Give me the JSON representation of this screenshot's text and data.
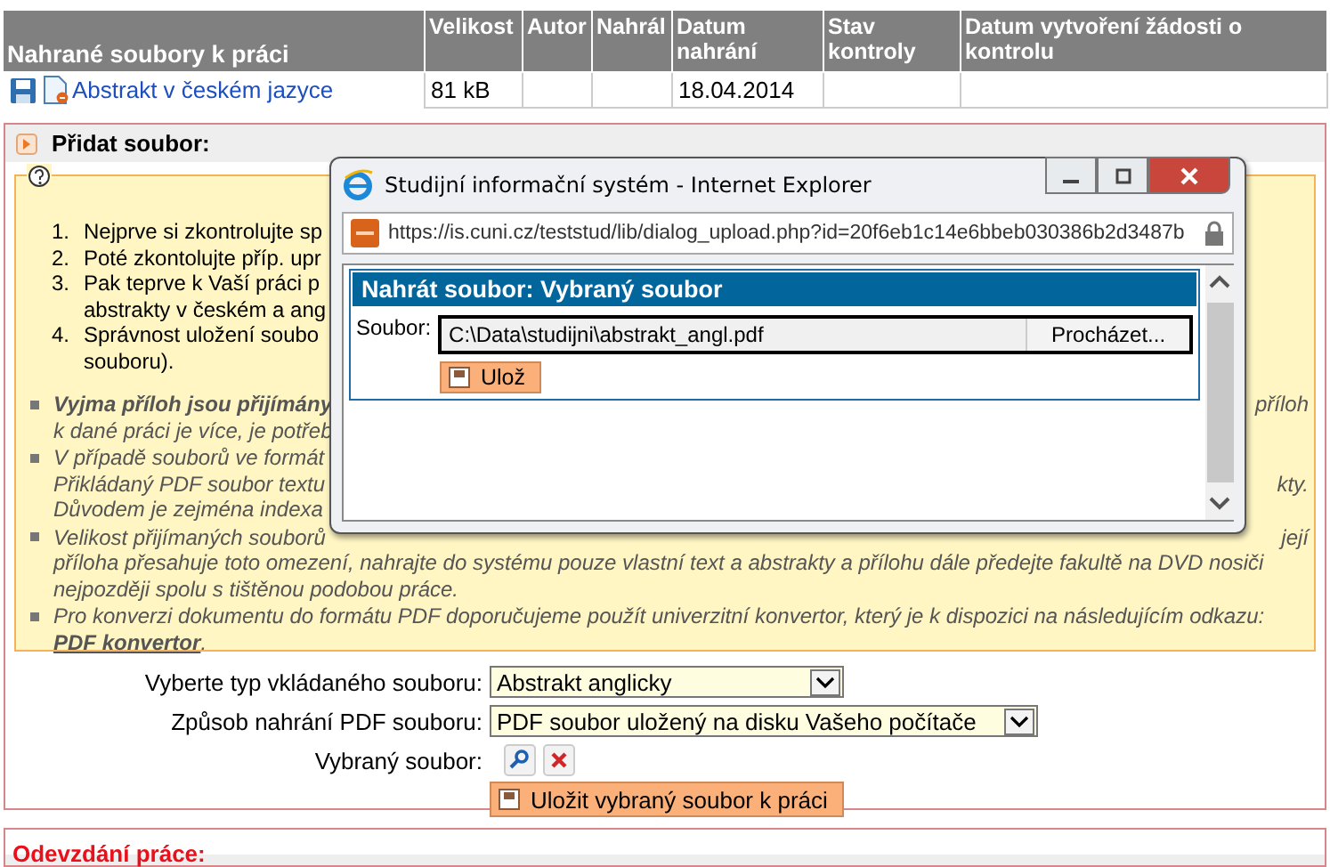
{
  "files_table": {
    "columns": [
      "Nahrané soubory k práci",
      "Velikost",
      "Autor",
      "Nahrál",
      "Datum nahrání",
      "Stav kontroly",
      "Datum vytvoření žádosti o kontrolu"
    ],
    "rows": [
      {
        "name": "Abstrakt v českém jazyce",
        "size": "81 kB",
        "uploaded": "18.04.2014"
      }
    ]
  },
  "add_section": {
    "title": "Přidat soubor:"
  },
  "notice": {
    "lines": [
      {
        "kind": "numbered",
        "number": "1.",
        "text": "Nejprve si zkontrolujte sp"
      },
      {
        "kind": "numbered",
        "number": "2.",
        "text": "Poté zkontolujte příp. upr"
      },
      {
        "kind": "numbered",
        "number": "3.",
        "text": "Pak teprve k Vaší práci p"
      },
      {
        "kind": "numbered_cont",
        "text": "abstrakty v českém a ang"
      },
      {
        "kind": "numbered",
        "number": "4.",
        "text": "Správnost uložení soubo"
      },
      {
        "kind": "numbered_cont",
        "text": "souboru)."
      },
      {
        "kind": "bullet",
        "text": "Vyjma příloh jsou přijímány",
        "emphasis": true,
        "right": "příloh"
      },
      {
        "kind": "bullet_cont",
        "text": "k dané práci je více, je potřeb"
      },
      {
        "kind": "bullet",
        "text": "V případě souborů ve formát"
      },
      {
        "kind": "bullet_cont",
        "text": "Přikládaný PDF soubor textu",
        "right": "kty."
      },
      {
        "kind": "bullet_cont",
        "text": "Důvodem je zejména indexa"
      },
      {
        "kind": "bullet",
        "text": "Velikost přijímaných souborů",
        "right": "její"
      },
      {
        "kind": "bullet_cont",
        "text": "příloha přesahuje toto omezení, nahrajte do systému pouze vlastní text a abstrakty a přílohu dále předejte fakultě na DVD nosiči"
      },
      {
        "kind": "bullet_cont",
        "text": "nejpozději spolu s tištěnou podobou práce."
      },
      {
        "kind": "bullet",
        "text": "Pro konverzi dokumentu do formátu PDF doporučujeme použít univerzitní konvertor, který je k dispozici na následujícím odkazu:"
      },
      {
        "kind": "bullet_cont",
        "link": "PDF konvertor",
        "text": "."
      }
    ]
  },
  "form": {
    "fields": [
      {
        "kind": "select",
        "label": "Vyberte typ vkládaného souboru:",
        "value": "Abstrakt anglicky"
      },
      {
        "kind": "select",
        "label": "Způsob nahrání PDF souboru:",
        "value": "PDF soubor uložený na disku Vašeho počítače"
      },
      {
        "kind": "file_actions",
        "label": "Vybraný soubor:"
      }
    ],
    "save_button": "Uložit vybraný soubor k práci"
  },
  "submit_section": {
    "title": "Odevzdání práce:"
  },
  "popup": {
    "title": "Studijní informační systém - Internet Explorer",
    "url": "https://is.cuni.cz/teststud/lib/dialog_upload.php?id=20f6eb1c14e6bbeb030386b2d3487b",
    "heading": "Nahrát soubor: Vybraný soubor",
    "file_label": "Soubor:",
    "file_value": "C:\\Data\\studijni\\abstrakt_angl.pdf",
    "browse_button": "Procházet...",
    "save_button": "Ulož"
  }
}
